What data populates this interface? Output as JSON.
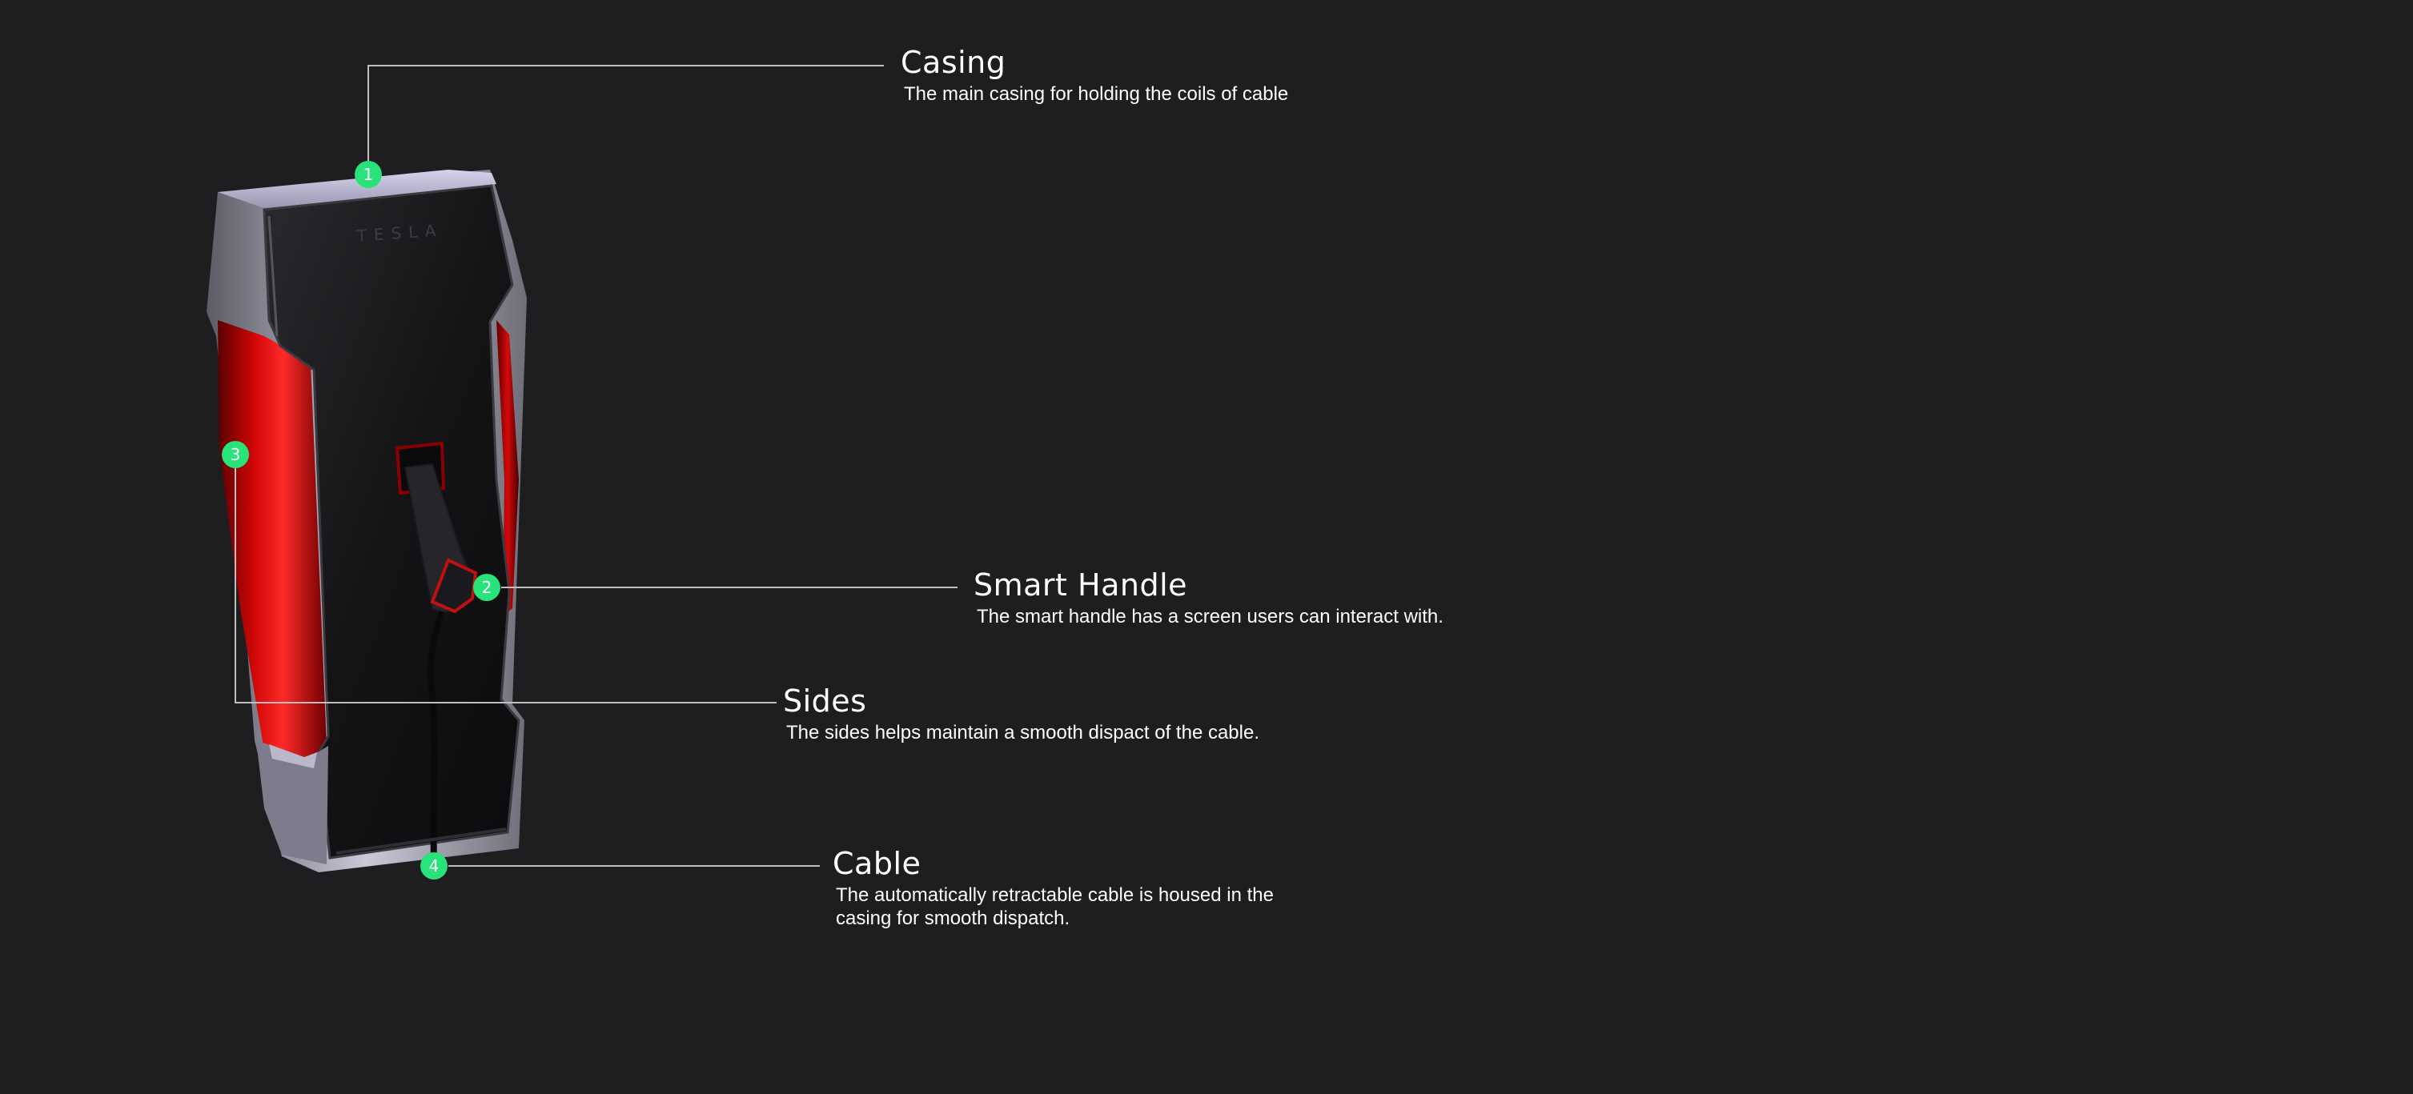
{
  "device": {
    "logo_text": "TESLA"
  },
  "callouts": [
    {
      "number": "1",
      "title": "Casing",
      "description": "The main casing for holding the coils of cable"
    },
    {
      "number": "2",
      "title": "Smart Handle",
      "description": "The smart handle has a screen users can interact with."
    },
    {
      "number": "3",
      "title": "Sides",
      "description": "The sides helps maintain a smooth dispact of the cable."
    },
    {
      "number": "4",
      "title": "Cable",
      "description": "The automatically retractable cable is housed in the casing for smooth dispatch."
    }
  ],
  "colors": {
    "background": "#1e1e20",
    "marker": "#27e37a",
    "leader_line": "#bfbfbf",
    "body_red": "#c00000",
    "body_dark": "#141416",
    "trim_grey": "#9a9aa3",
    "text": "#ffffff"
  }
}
